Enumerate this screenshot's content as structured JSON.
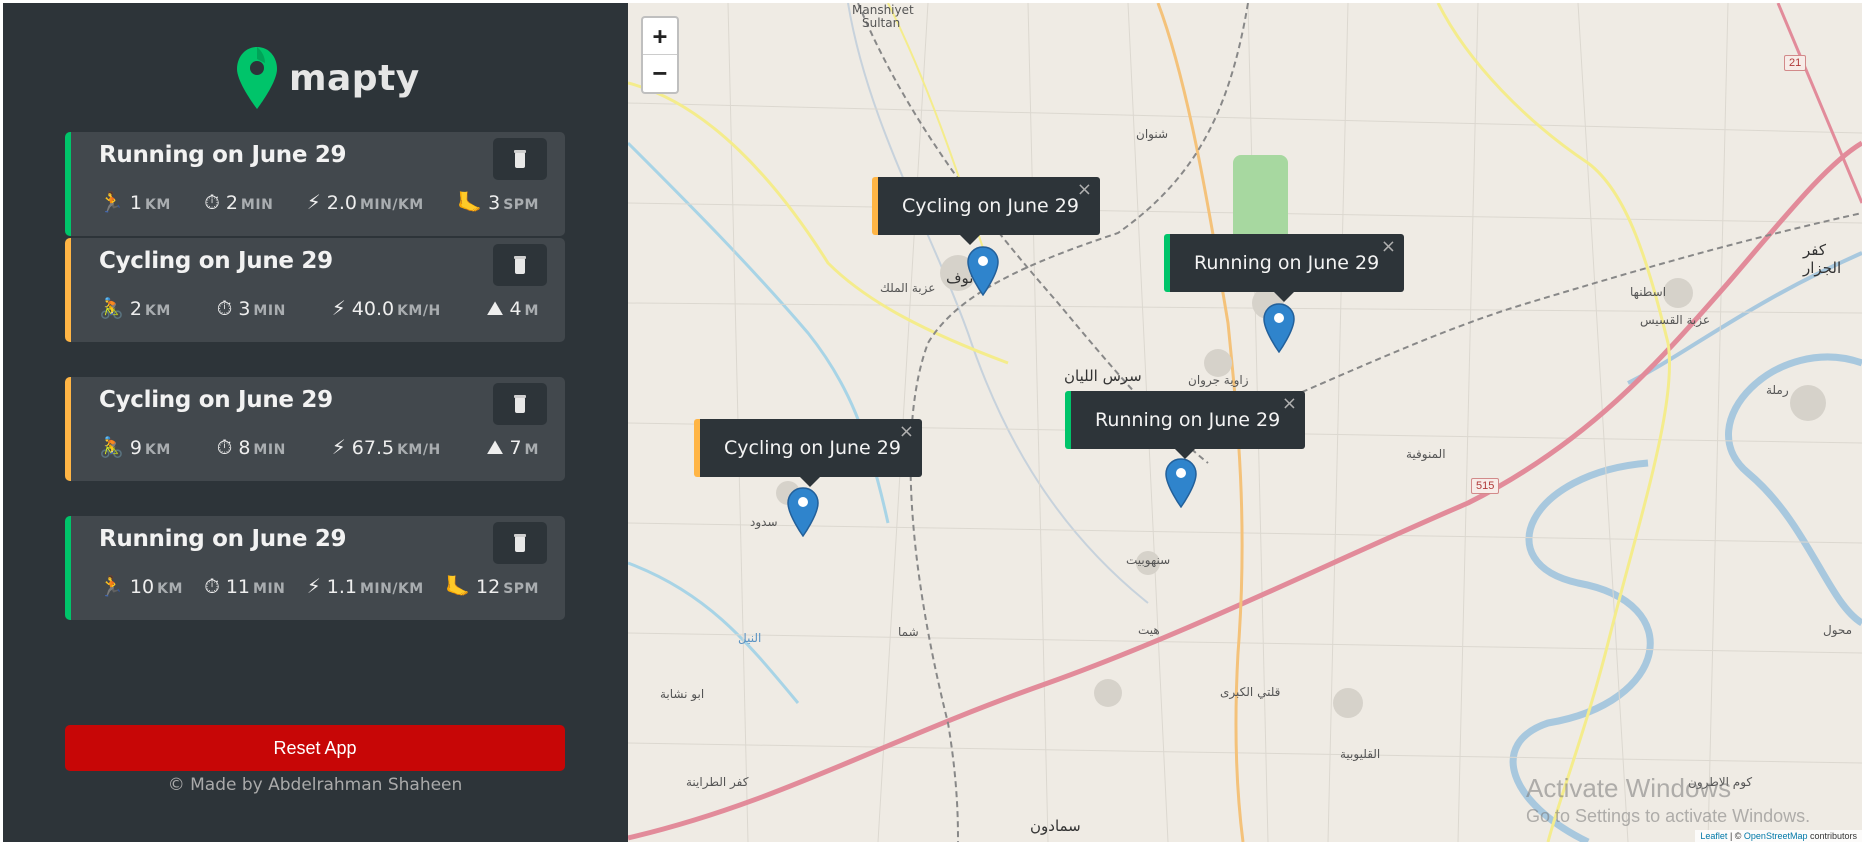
{
  "app": {
    "name": "mapty"
  },
  "workouts": [
    {
      "type": "running",
      "title": "Running on June 29",
      "stats": [
        {
          "icon": "runner-icon",
          "glyph": "🏃",
          "value": "1",
          "unit": "KM"
        },
        {
          "icon": "stopwatch-icon",
          "glyph": "⏱",
          "value": "2",
          "unit": "MIN"
        },
        {
          "icon": "lightning-icon",
          "glyph": "⚡",
          "value": "2.0",
          "unit": "MIN/KM"
        },
        {
          "icon": "foot-icon",
          "glyph": "🦶",
          "value": "3",
          "unit": "SPM"
        }
      ]
    },
    {
      "type": "cycling",
      "title": "Cycling on June 29",
      "stats": [
        {
          "icon": "bicycle-icon",
          "glyph": "🚴",
          "value": "2",
          "unit": "KM"
        },
        {
          "icon": "stopwatch-icon",
          "glyph": "⏱",
          "value": "3",
          "unit": "MIN"
        },
        {
          "icon": "lightning-icon",
          "glyph": "⚡",
          "value": "40.0",
          "unit": "KM/H"
        },
        {
          "icon": "mountain-icon",
          "glyph": "⛰",
          "value": "4",
          "unit": "M"
        }
      ]
    },
    {
      "type": "cycling",
      "title": "Cycling on June 29",
      "stats": [
        {
          "icon": "bicycle-icon",
          "glyph": "🚴",
          "value": "9",
          "unit": "KM"
        },
        {
          "icon": "stopwatch-icon",
          "glyph": "⏱",
          "value": "8",
          "unit": "MIN"
        },
        {
          "icon": "lightning-icon",
          "glyph": "⚡",
          "value": "67.5",
          "unit": "KM/H"
        },
        {
          "icon": "mountain-icon",
          "glyph": "⛰",
          "value": "7",
          "unit": "M"
        }
      ]
    },
    {
      "type": "running",
      "title": "Running on June 29",
      "stats": [
        {
          "icon": "runner-icon",
          "glyph": "🏃",
          "value": "10",
          "unit": "KM"
        },
        {
          "icon": "stopwatch-icon",
          "glyph": "⏱",
          "value": "11",
          "unit": "MIN"
        },
        {
          "icon": "lightning-icon",
          "glyph": "⚡",
          "value": "1.1",
          "unit": "MIN/KM"
        },
        {
          "icon": "foot-icon",
          "glyph": "🦶",
          "value": "12",
          "unit": "SPM"
        }
      ]
    }
  ],
  "reset_label": "Reset App",
  "copyright": "© Made by Abdelrahman Shaheen",
  "map": {
    "zoom_in": "+",
    "zoom_out": "−",
    "popups": [
      {
        "type": "cycling",
        "label": "Cycling on June 29"
      },
      {
        "type": "running",
        "label": "Running on June 29"
      },
      {
        "type": "running",
        "label": "Running on June 29"
      },
      {
        "type": "cycling",
        "label": "Cycling on June 29"
      }
    ],
    "close_glyph": "×",
    "labels": {
      "l1": "Manshiyet",
      "l2": "Sultan",
      "l3": "شنوان",
      "l4": "عزبة الملك",
      "l5": "نوف",
      "l6": "سرس الليان",
      "l7": "زاوية جروان",
      "l8": "اسطنها",
      "l9": "عزبة القسيس",
      "l10": "كفر الجزار",
      "l11": "رملة",
      "l12": "سنهوبيت",
      "l13": "شما",
      "l14": "هيت",
      "l15": "قلتي الكبرى",
      "l16": "النيل",
      "l17": "ابو نشابة",
      "l18": "كفر الطراينة",
      "l19": "سمادون",
      "l20": "كوم الاطرون",
      "l21": "محول",
      "l22": "سدود",
      "l23": "المنوفية",
      "l24": "القليوبية"
    },
    "shields": {
      "s1": "21",
      "s2": "515"
    },
    "attribution": {
      "leaflet": "Leaflet",
      "sep": " | © ",
      "osm": "OpenStreetMap",
      "rest": " contributors"
    }
  },
  "watermark": {
    "line1": "Activate Windows",
    "line2": "Go to Settings to activate Windows."
  },
  "colors": {
    "running": "#00c46a",
    "cycling": "#ffb545",
    "sidebar": "#2d3439",
    "card": "#42484d",
    "reset": "#c70606"
  }
}
